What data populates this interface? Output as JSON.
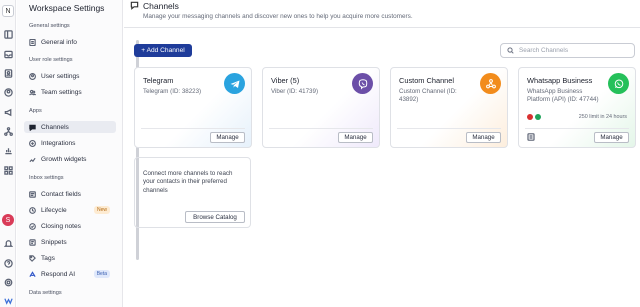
{
  "rail": {
    "org_initial": "N",
    "avatar_initial": "S",
    "icons": [
      "layout-icon",
      "inbox-icon",
      "contacts-icon",
      "user-circle-icon",
      "megaphone-icon",
      "workflow-icon",
      "reports-icon",
      "apps-icon",
      "bell-icon",
      "help-icon",
      "logo-icon"
    ]
  },
  "sidebar": {
    "title": "Workspace Settings",
    "sections": [
      {
        "label": "General settings",
        "items": [
          {
            "label": "General info",
            "icon": "document-icon"
          }
        ]
      },
      {
        "label": "User role settings",
        "items": [
          {
            "label": "User settings",
            "icon": "user-icon"
          },
          {
            "label": "Team settings",
            "icon": "team-icon"
          }
        ]
      },
      {
        "label": "Apps",
        "items": [
          {
            "label": "Channels",
            "icon": "channels-icon",
            "active": true
          },
          {
            "label": "Integrations",
            "icon": "integrations-icon"
          },
          {
            "label": "Growth widgets",
            "icon": "growth-icon"
          }
        ]
      },
      {
        "label": "Inbox settings",
        "items": [
          {
            "label": "Contact fields",
            "icon": "contact-fields-icon"
          },
          {
            "label": "Lifecycle",
            "icon": "lifecycle-icon",
            "badge": "New"
          },
          {
            "label": "Closing notes",
            "icon": "closing-notes-icon"
          },
          {
            "label": "Snippets",
            "icon": "snippets-icon"
          },
          {
            "label": "Tags",
            "icon": "tag-icon"
          },
          {
            "label": "Respond AI",
            "icon": "ai-icon",
            "badge": "Beta"
          }
        ]
      },
      {
        "label": "Data settings",
        "items": []
      }
    ]
  },
  "header": {
    "title": "Channels",
    "subtitle": "Manage your messaging channels and discover new ones to help you acquire more customers."
  },
  "toolbar": {
    "add_label": "+ Add Channel",
    "search_placeholder": "Search Channels"
  },
  "channels": [
    {
      "name": "Telegram",
      "detail": "Telegram (ID: 38223)",
      "manage": "Manage",
      "icon": "telegram-icon",
      "color": "#2aa3df"
    },
    {
      "name": "Viber (5)",
      "detail": "Viber (ID: 41739)",
      "manage": "Manage",
      "icon": "viber-icon",
      "color": "#6c4fa8"
    },
    {
      "name": "Custom Channel",
      "detail": "Custom Channel (ID: 43892)",
      "manage": "Manage",
      "icon": "webhook-icon",
      "color": "#f28c1c"
    },
    {
      "name": "Whatsapp Business",
      "detail": "WhatsApp Business Platform (API) (ID: 47744)",
      "manage": "Manage",
      "icon": "whatsapp-icon",
      "color": "#25c05a",
      "limit": "250 limit in 24 hours"
    }
  ],
  "more": {
    "text": "Connect more channels to reach your contacts in their preferred channels",
    "browse": "Browse Catalog"
  },
  "colors": {
    "accent": "#1f3c9a",
    "status_error": "#d93030",
    "status_ok": "#21a35b"
  }
}
